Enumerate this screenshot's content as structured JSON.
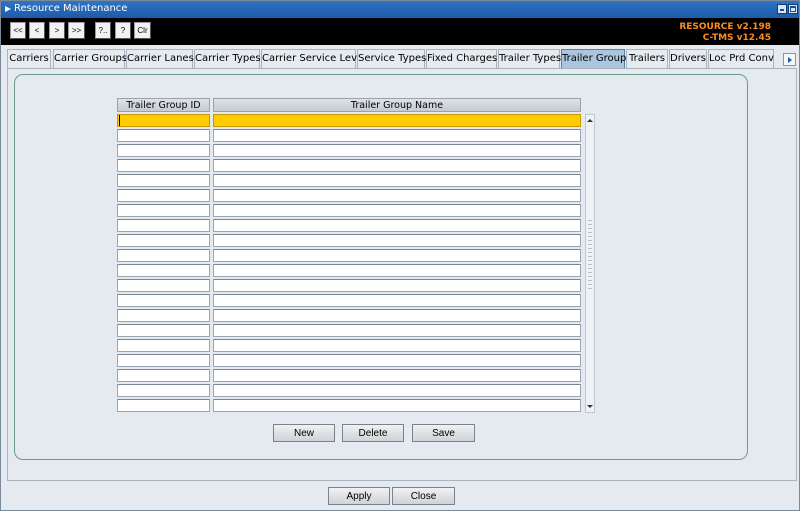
{
  "window": {
    "title": "Resource Maintenance"
  },
  "toolbar": {
    "buttons": [
      {
        "label": "<<"
      },
      {
        "label": "<"
      },
      {
        "label": ">"
      },
      {
        "label": ">>"
      },
      {
        "label": "?.."
      },
      {
        "label": "?"
      },
      {
        "label": "Clr"
      }
    ],
    "version_line1": "RESOURCE v2.198",
    "version_line2": "C-TMS v12.45",
    "version_color": "#ff8c1a"
  },
  "tabs": [
    {
      "label": "Carriers"
    },
    {
      "label": "Carrier Groups"
    },
    {
      "label": "Carrier Lanes"
    },
    {
      "label": "Carrier Types"
    },
    {
      "label": "Carrier Service Level"
    },
    {
      "label": "Service Types"
    },
    {
      "label": "Fixed Charges"
    },
    {
      "label": "Trailer Types"
    },
    {
      "label": "Trailer Group",
      "active": true
    },
    {
      "label": "Trailers"
    },
    {
      "label": "Drivers"
    },
    {
      "label": "Loc Prd Conv"
    }
  ],
  "grid": {
    "columns": {
      "id": "Trailer Group ID",
      "name": "Trailer Group Name"
    },
    "row_count": 20,
    "selected_row": 0,
    "selected_color": "#ffcc00"
  },
  "actions": {
    "new_label": "New",
    "delete_label": "Delete",
    "save_label": "Save"
  },
  "footer": {
    "apply_label": "Apply",
    "close_label": "Close"
  }
}
